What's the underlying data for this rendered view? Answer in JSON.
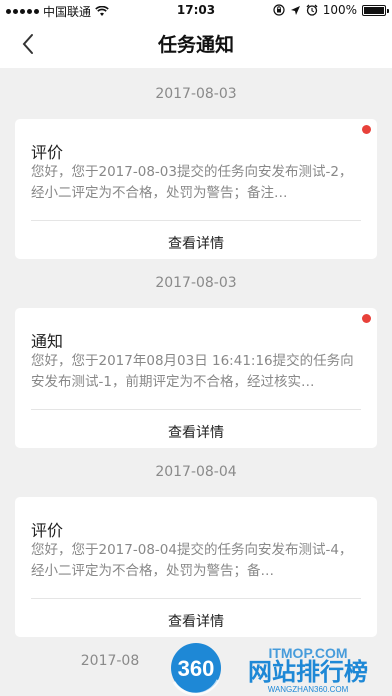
{
  "status": {
    "carrier": "中国联通",
    "time": "17:03",
    "battery": "100%",
    "battery_level": 1.0
  },
  "nav": {
    "title": "任务通知"
  },
  "notifications": [
    {
      "date": "2017-08-03",
      "title": "评价",
      "body": "您好，您于2017-08-03提交的任务向安发布测试-2，经小二评定为不合格，处罚为警告；备注…",
      "detail_label": "查看详情",
      "unread": true
    },
    {
      "date": "2017-08-03",
      "title": "通知",
      "body": "您好，您于2017年08月03日 16:41:16提交的任务向安发布测试-1，前期评定为不合格，经过核实…",
      "detail_label": "查看详情",
      "unread": true
    },
    {
      "date": "2017-08-04",
      "title": "评价",
      "body": "您好，您于2017-08-04提交的任务向安发布测试-4，经小二评定为不合格，处罚为警告；备…",
      "detail_label": "查看详情",
      "unread": false
    }
  ],
  "partial_date": "2017-08",
  "watermark": {
    "badge": "360",
    "title": "网站排行榜",
    "subtitle": "WANGZHAN360.COM",
    "overlay": "ITMOP.COM"
  }
}
